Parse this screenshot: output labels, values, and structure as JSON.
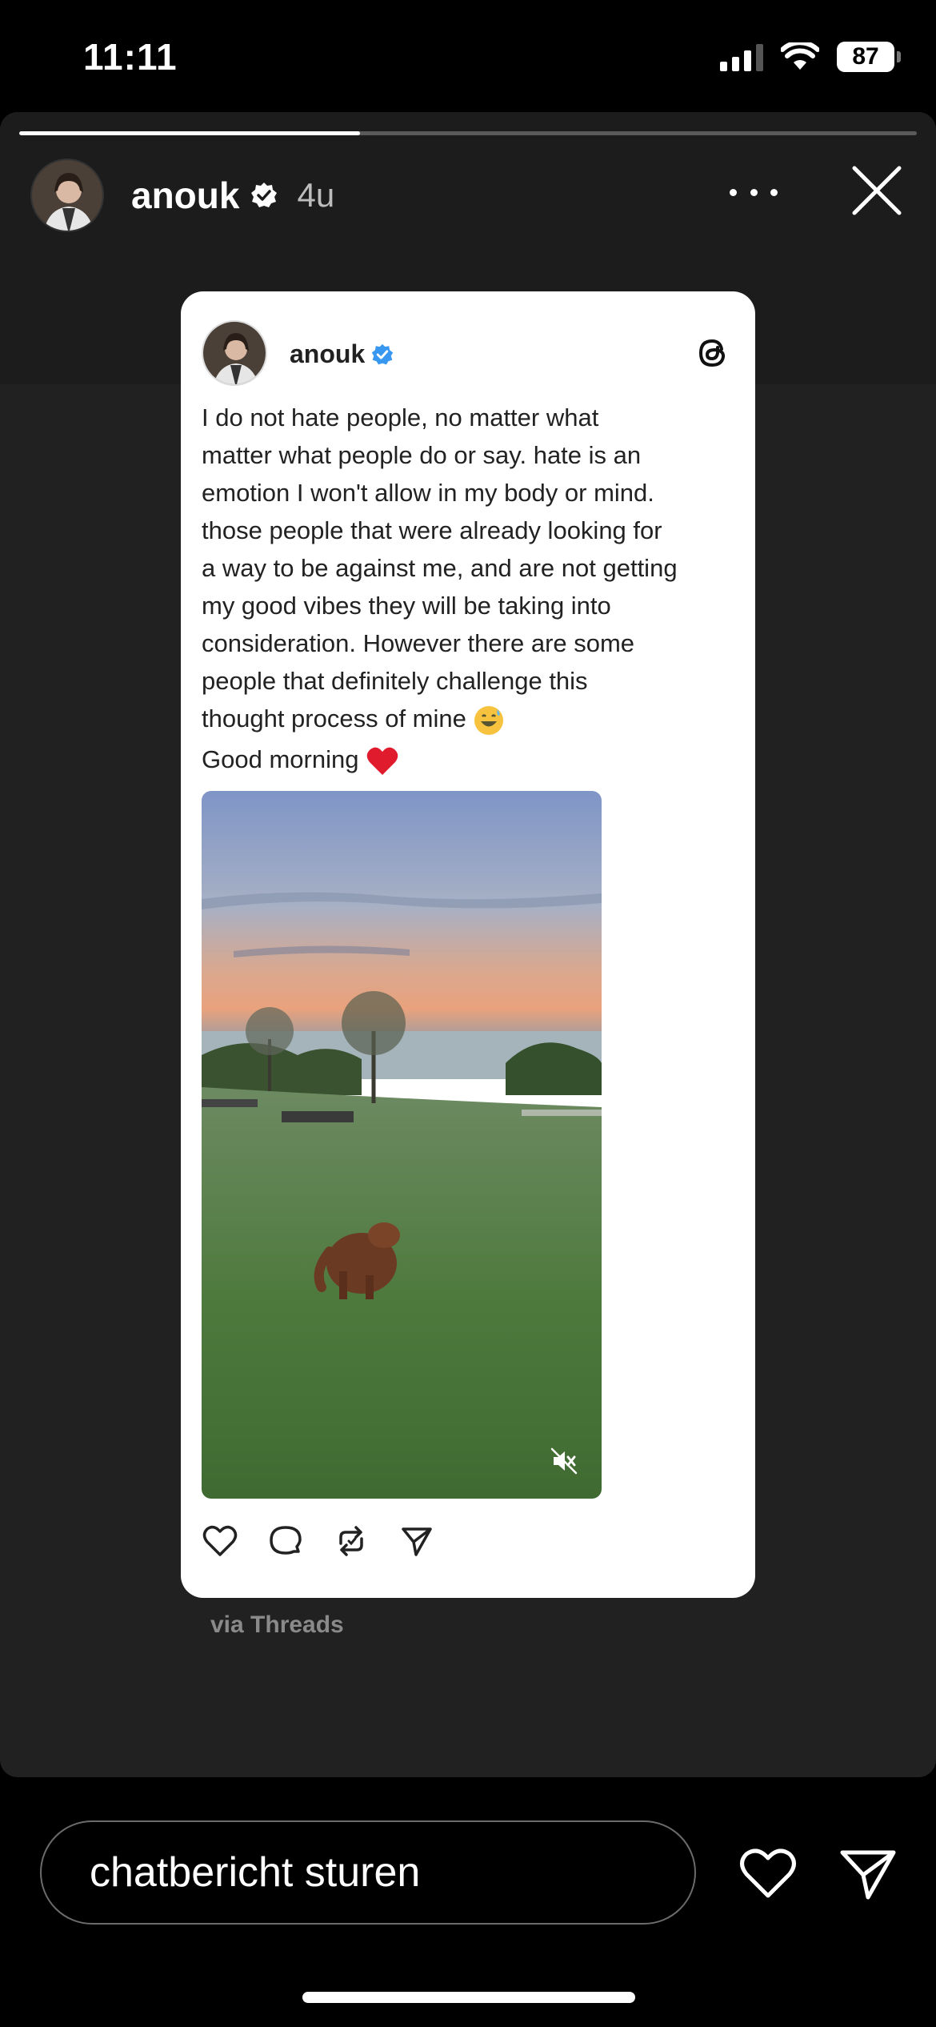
{
  "status_bar": {
    "time": "11:11",
    "battery": "87"
  },
  "story": {
    "progress": 0.38,
    "username": "anouk",
    "time_ago": "4u",
    "via": "via Threads"
  },
  "card": {
    "username": "anouk",
    "text_lines": [
      "I do not hate people, no matter what",
      "matter what people do or say. hate is an",
      "emotion I won't allow in my body or mind.",
      "those people that were already looking for",
      "a way to be against me, and are not getting",
      "my good vibes they will be taking into",
      "consideration. However there are some",
      "people that definitely challenge this",
      "thought process of mine"
    ],
    "last_line": "Good morning"
  },
  "reply": {
    "placeholder": "chatbericht sturen"
  },
  "colors": {
    "verified": "#3897f0",
    "story_bg": "#212121",
    "heart": "#e0245e"
  }
}
